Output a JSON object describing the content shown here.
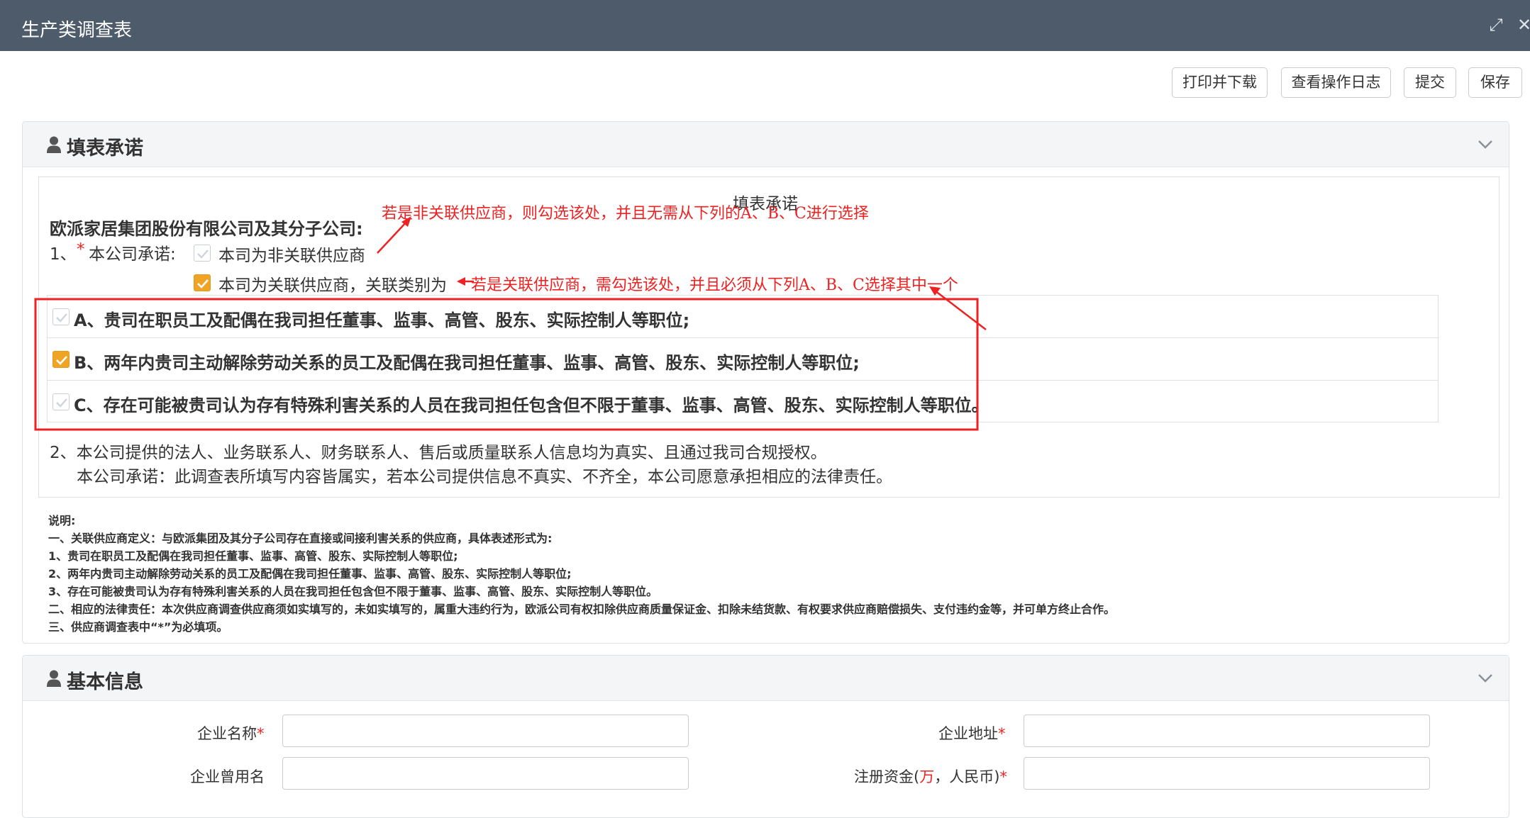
{
  "window": {
    "title": "生产类调查表",
    "maximize_icon": "⤢",
    "close_icon": "✕"
  },
  "toolbar": {
    "print_label": "打印并下载",
    "log_label": "查看操作日志",
    "submit_label": "提交",
    "save_label": "保存"
  },
  "commitment": {
    "panel_title": "填表承诺",
    "box_title": "填表承诺",
    "company": "欧派家居集团股份有限公司及其分子公司:",
    "item1_prefix": "1、",
    "required_mark": "*",
    "item1_label": "本公司承诺:",
    "non_related_option": "本司为非关联供应商",
    "non_related_checked": false,
    "related_option": "本司为关联供应商，关联类别为",
    "related_checked": true,
    "options": [
      {
        "text": "A、贵司在职员工及配偶在我司担任董事、监事、高管、股东、实际控制人等职位;",
        "checked": false
      },
      {
        "text": "B、两年内贵司主动解除劳动关系的员工及配偶在我司担任董事、监事、高管、股东、实际控制人等职位;",
        "checked": true
      },
      {
        "text": "C、存在可能被贵司认为存有特殊利害关系的人员在我司担任包含但不限于董事、监事、高管、股东、实际控制人等职位。",
        "checked": false
      }
    ],
    "item2_line1": "2、本公司提供的法人、业务联系人、财务联系人、售后或质量联系人信息均为真实、且通过我司合规授权。",
    "item2_line2": "本公司承诺：此调查表所填写内容皆属实，若本公司提供信息不真实、不齐全，本公司愿意承担相应的法律责任。",
    "annotation_1": "若是非关联供应商，则勾选该处，并且无需从下列的A、B、C进行选择",
    "annotation_2": "若是关联供应商，需勾选该处，并且必须从下列A、B、C选择其中一个",
    "notes": [
      "说明:",
      "一、关联供应商定义：与欧派集团及其分子公司存在直接或间接利害关系的供应商，具体表述形式为:",
      "1、贵司在职员工及配偶在我司担任董事、监事、高管、股东、实际控制人等职位;",
      "2、两年内贵司主动解除劳动关系的员工及配偶在我司担任董事、监事、高管、股东、实际控制人等职位;",
      "3、存在可能被贵司认为存有特殊利害关系的人员在我司担任包含但不限于董事、监事、高管、股东、实际控制人等职位。",
      "二、相应的法律责任：本次供应商调查供应商须如实填写的，未如实填写的，属重大违约行为，欧派公司有权扣除供应商质量保证金、扣除未结货款、有权要求供应商赔偿损失、支付违约金等，并可单方终止合作。",
      "三、供应商调查表中“*”为必填项。"
    ]
  },
  "basic_info": {
    "panel_title": "基本信息",
    "company_name_label": "企业名称",
    "company_address_label": "企业地址",
    "former_name_label": "企业曾用名",
    "capital_label_prefix": "注册资金(",
    "capital_label_unit": "万",
    "capital_label_suffix": "，人民币)",
    "required_mark": "*",
    "company_name_value": "",
    "company_address_value": "",
    "former_name_value": "",
    "capital_value": ""
  },
  "colors": {
    "titlebar": "#4d5b6a",
    "checkbox_checked": "#f0a424",
    "annotation_red": "#ee2222"
  }
}
